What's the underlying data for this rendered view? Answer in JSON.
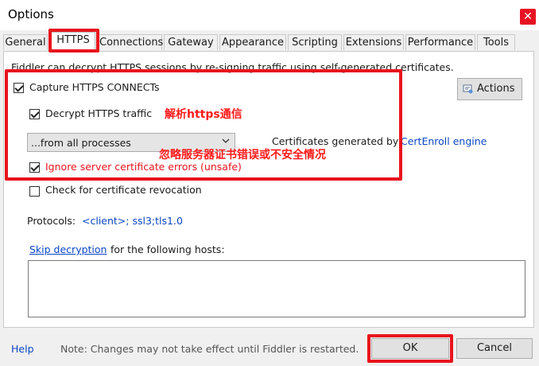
{
  "window": {
    "title": "Options",
    "close_glyph": "✕"
  },
  "tabs": [
    "General",
    "HTTPS",
    "Connections",
    "Gateway",
    "Appearance",
    "Scripting",
    "Extensions",
    "Performance",
    "Tools"
  ],
  "https": {
    "description": "Fiddler can decrypt HTTPS sessions by re-signing traffic using self-generated certificates.",
    "capture_label": "Capture HTTPS CONNECTs",
    "decrypt_label": "Decrypt HTTPS traffic",
    "process_select": "...from all processes",
    "cert_text": "Certificates generated by",
    "cert_engine": "CertEnroll engine",
    "ignore_errors_label": "Ignore server certificate errors (unsafe)",
    "revocation_label": "Check for certificate revocation",
    "protocols_label": "Protocols:",
    "protocols_value": "<client>; ssl3;tls1.0",
    "skip_link": "Skip decryption",
    "skip_text": "for the following hosts:",
    "actions_label": "Actions",
    "hosts_value": ""
  },
  "annotations": {
    "decrypt_note": "解析https通信",
    "ignore_note": "忽略服务器证书错误或不安全情况"
  },
  "footer": {
    "help": "Help",
    "note": "Note: Changes may not take effect until Fiddler is restarted.",
    "ok": "OK",
    "cancel": "Cancel"
  },
  "colors": {
    "annotation_red": "#e8141d",
    "link_blue": "#0b47c5"
  }
}
